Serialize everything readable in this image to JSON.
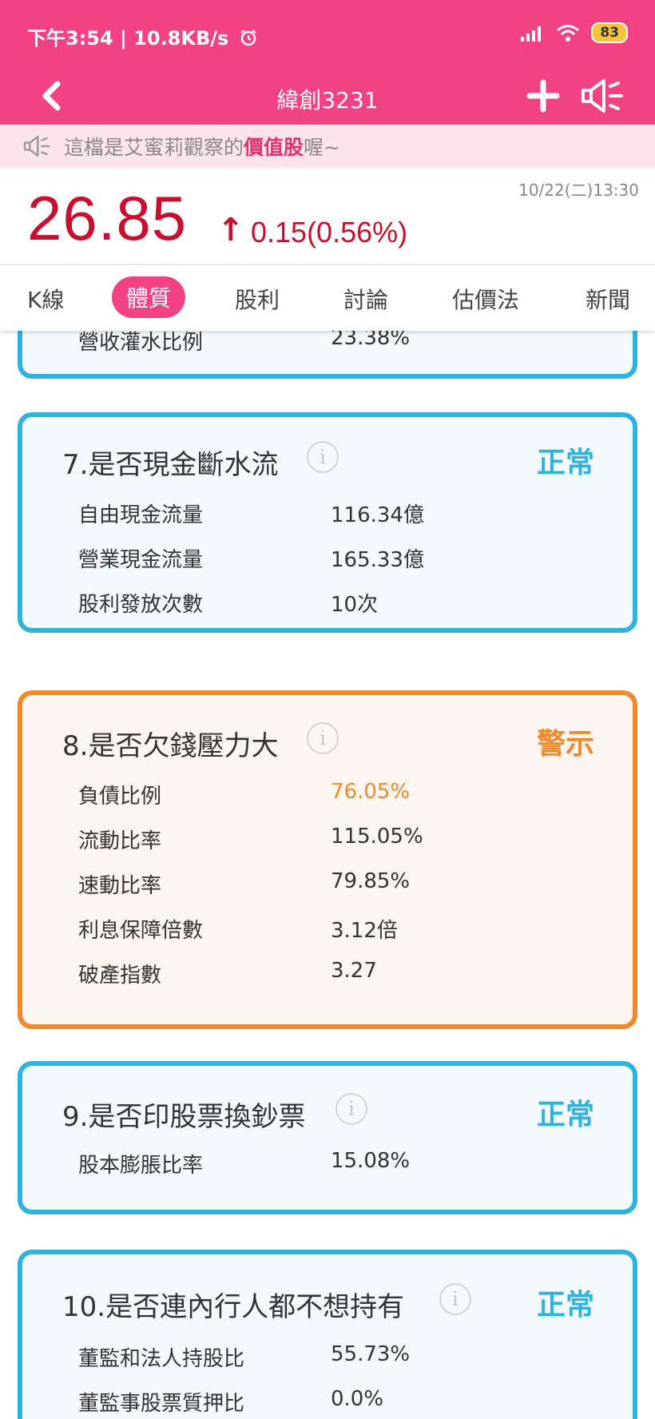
{
  "status_bar": {
    "time": "下午3:54 | 10.8KB/s",
    "battery": "83"
  },
  "app_bar": {
    "title": "緯創3231"
  },
  "notice": {
    "prefix": "這檔是艾蜜莉觀察的",
    "highlight": "價值股",
    "suffix": "喔~"
  },
  "quote": {
    "price": "26.85",
    "arrow": "↑",
    "change": "0.15(0.56%)",
    "datetime": "10/22(二)13:30"
  },
  "tabs": [
    {
      "label": "K線"
    },
    {
      "label": "體質"
    },
    {
      "label": "股利"
    },
    {
      "label": "討論"
    },
    {
      "label": "估價法"
    },
    {
      "label": "新聞"
    }
  ],
  "partial_card": {
    "label": "營收灌水比例",
    "value": "23.38%"
  },
  "cards": [
    {
      "title": "7.是否現金斷水流",
      "status": "正常",
      "rows": [
        {
          "label": "自由現金流量",
          "value": "116.34億"
        },
        {
          "label": "營業現金流量",
          "value": "165.33億"
        },
        {
          "label": "股利發放次數",
          "value": "10次"
        }
      ]
    },
    {
      "title": "8.是否欠錢壓力大",
      "status": "警示",
      "rows": [
        {
          "label": "負債比例",
          "value": "76.05%"
        },
        {
          "label": "流動比率",
          "value": "115.05%"
        },
        {
          "label": "速動比率",
          "value": "79.85%"
        },
        {
          "label": "利息保障倍數",
          "value": "3.12倍"
        },
        {
          "label": "破產指數",
          "value": "3.27"
        }
      ]
    },
    {
      "title": "9.是否印股票換鈔票",
      "status": "正常",
      "rows": [
        {
          "label": "股本膨脹比率",
          "value": "15.08%"
        }
      ]
    },
    {
      "title": "10.是否連內行人都不想持有",
      "status": "正常",
      "rows": [
        {
          "label": "董監和法人持股比",
          "value": "55.73%"
        },
        {
          "label": "董監事股票質押比",
          "value": "0.0%"
        }
      ]
    }
  ],
  "info_glyph": "i",
  "colors": {
    "brand_pink": "#f24283",
    "price_red": "#c8102e",
    "normal_blue": "#2db3dd",
    "warning_orange": "#f1892a"
  },
  "icons": {
    "back": "chevron-left-icon",
    "add": "plus-icon",
    "speaker": "megaphone-icon",
    "info": "info-icon"
  }
}
